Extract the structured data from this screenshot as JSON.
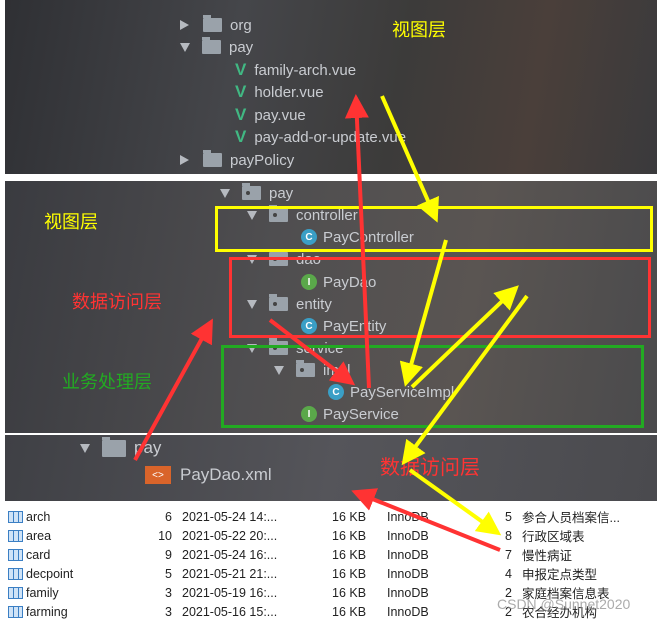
{
  "frontend_tree": {
    "items": [
      {
        "name": "org",
        "type": "folder",
        "expanded": false
      },
      {
        "name": "pay",
        "type": "folder",
        "expanded": true
      },
      {
        "name": "family-arch.vue",
        "type": "vue"
      },
      {
        "name": "holder.vue",
        "type": "vue"
      },
      {
        "name": "pay.vue",
        "type": "vue"
      },
      {
        "name": "pay-add-or-update.vue",
        "type": "vue"
      },
      {
        "name": "payPolicy",
        "type": "folder",
        "expanded": false
      }
    ],
    "layer_label": "视图层"
  },
  "backend_tree": {
    "items": [
      {
        "name": "pay",
        "type": "package"
      },
      {
        "name": "controller",
        "type": "package"
      },
      {
        "name": "PayController",
        "type": "class",
        "badge": "C"
      },
      {
        "name": "dao",
        "type": "package"
      },
      {
        "name": "PayDao",
        "type": "interface",
        "badge": "I"
      },
      {
        "name": "entity",
        "type": "package"
      },
      {
        "name": "PayEntity",
        "type": "class",
        "badge": "C"
      },
      {
        "name": "service",
        "type": "package"
      },
      {
        "name": "impl",
        "type": "package"
      },
      {
        "name": "PayServiceImpl",
        "type": "class",
        "badge": "C"
      },
      {
        "name": "PayService",
        "type": "interface",
        "badge": "I"
      }
    ],
    "labels": {
      "view": "视图层",
      "data_access": "数据访问层",
      "business": "业务处理层"
    },
    "colors": {
      "view": "#ffff00",
      "data_access": "#ff3333",
      "business": "#22aa22"
    }
  },
  "mapper_tree": {
    "items": [
      {
        "name": "pay",
        "type": "folder"
      },
      {
        "name": "PayDao.xml",
        "type": "xml"
      }
    ],
    "layer_label": "数据访问层"
  },
  "db_tables": {
    "rows": [
      {
        "name": "arch",
        "rows": "6",
        "modified": "2021-05-24 14:...",
        "size": "16 KB",
        "engine": "InnoDB",
        "auto_inc": "5",
        "comment": "参合人员档案信..."
      },
      {
        "name": "area",
        "rows": "10",
        "modified": "2021-05-22 20:...",
        "size": "16 KB",
        "engine": "InnoDB",
        "auto_inc": "8",
        "comment": "行政区域表"
      },
      {
        "name": "card",
        "rows": "9",
        "modified": "2021-05-24 16:...",
        "size": "16 KB",
        "engine": "InnoDB",
        "auto_inc": "7",
        "comment": "慢性病证"
      },
      {
        "name": "decpoint",
        "rows": "5",
        "modified": "2021-05-21 21:...",
        "size": "16 KB",
        "engine": "InnoDB",
        "auto_inc": "4",
        "comment": "申报定点类型"
      },
      {
        "name": "family",
        "rows": "3",
        "modified": "2021-05-19 16:...",
        "size": "16 KB",
        "engine": "InnoDB",
        "auto_inc": "2",
        "comment": "家庭档案信息表"
      },
      {
        "name": "farming",
        "rows": "3",
        "modified": "2021-05-16 15:...",
        "size": "16 KB",
        "engine": "InnoDB",
        "auto_inc": "2",
        "comment": "农合经办机构"
      }
    ]
  },
  "watermark": "CSDN @Sunnet2020"
}
